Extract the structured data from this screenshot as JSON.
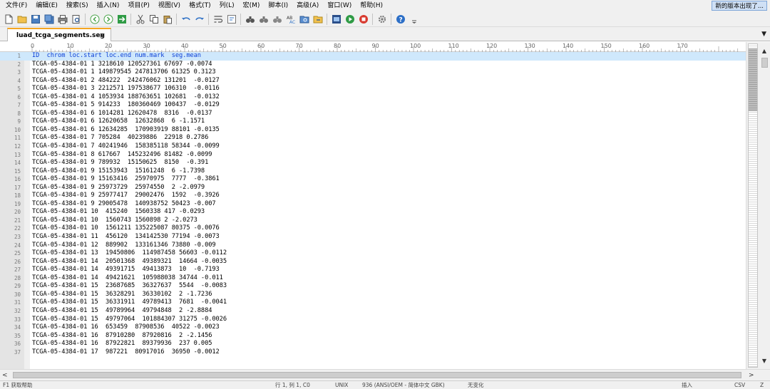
{
  "menu": [
    "文件(F)",
    "编辑(E)",
    "搜索(S)",
    "插入(N)",
    "项目(P)",
    "视图(V)",
    "格式(T)",
    "列(L)",
    "宏(M)",
    "脚本(I)",
    "高级(A)",
    "窗口(W)",
    "帮助(H)"
  ],
  "update_badge": "新的版本出现了...",
  "toolbar_icons": [
    "new-file-icon",
    "open-folder-icon",
    "save-icon",
    "save-all-icon",
    "print-icon",
    "print-preview-icon",
    "back-icon",
    "forward-icon",
    "jump-icon",
    "cut-icon",
    "copy-icon",
    "paste-icon",
    "undo-icon",
    "redo-icon",
    "word-wrap-icon",
    "show-all-chars-icon",
    "find-icon",
    "find-next-icon",
    "find-in-files-icon",
    "replace-icon",
    "find-files-icon",
    "go-to-icon",
    "macro-icon",
    "run-icon",
    "stop-icon",
    "settings-icon",
    "help-icon"
  ],
  "tab": {
    "label": "luad_tcga_segments.seg",
    "close": "×"
  },
  "tab_list_arrow": "▼",
  "ruler": {
    "labels": [
      "0",
      "10",
      "20",
      "30",
      "40",
      "50",
      "60",
      "70",
      "80",
      "90",
      "100",
      "110",
      "120",
      "130",
      "140",
      "150",
      "160",
      "170"
    ]
  },
  "lines": [
    {
      "n": "1",
      "text": "ID  chrom loc.start loc.end num.mark  seg.mean"
    },
    {
      "n": "2",
      "text": "TCGA-05-4384-01 1 3218610 120527361 67697 -0.0074"
    },
    {
      "n": "3",
      "text": "TCGA-05-4384-01 1 149879545 247813706 61325 0.3123"
    },
    {
      "n": "4",
      "text": "TCGA-05-4384-01 2 484222  242476062 131201  -0.0127"
    },
    {
      "n": "5",
      "text": "TCGA-05-4384-01 3 2212571 197538677 106310  -0.0116"
    },
    {
      "n": "6",
      "text": "TCGA-05-4384-01 4 1053934 188763651 102681  -0.0132"
    },
    {
      "n": "7",
      "text": "TCGA-05-4384-01 5 914233  180360469 100437  -0.0129"
    },
    {
      "n": "8",
      "text": "TCGA-05-4384-01 6 1014281 12620478  8316  -0.0137"
    },
    {
      "n": "9",
      "text": "TCGA-05-4384-01 6 12620658  12632868  6 -1.1571"
    },
    {
      "n": "10",
      "text": "TCGA-05-4384-01 6 12634285  170903919 88101 -0.0135"
    },
    {
      "n": "11",
      "text": "TCGA-05-4384-01 7 705284  40239886  22918 0.2786"
    },
    {
      "n": "12",
      "text": "TCGA-05-4384-01 7 40241946  158385118 58344 -0.0099"
    },
    {
      "n": "13",
      "text": "TCGA-05-4384-01 8 617667  145232496 81482 -0.0099"
    },
    {
      "n": "14",
      "text": "TCGA-05-4384-01 9 789932  15150625  8150  -0.391"
    },
    {
      "n": "15",
      "text": "TCGA-05-4384-01 9 15153943  15161248  6 -1.7398"
    },
    {
      "n": "16",
      "text": "TCGA-05-4384-01 9 15163416  25970975  7777  -0.3861"
    },
    {
      "n": "17",
      "text": "TCGA-05-4384-01 9 25973729  25974550  2 -2.0979"
    },
    {
      "n": "18",
      "text": "TCGA-05-4384-01 9 25977417  29002476  1592  -0.3926"
    },
    {
      "n": "19",
      "text": "TCGA-05-4384-01 9 29005478  140938752 50423 -0.007"
    },
    {
      "n": "20",
      "text": "TCGA-05-4384-01 10  415240  1560338 417 -0.0293"
    },
    {
      "n": "21",
      "text": "TCGA-05-4384-01 10  1560743 1560898 2 -2.0273"
    },
    {
      "n": "22",
      "text": "TCGA-05-4384-01 10  1561211 135225087 80375 -0.0076"
    },
    {
      "n": "23",
      "text": "TCGA-05-4384-01 11  456120  134142530 77194 -0.0073"
    },
    {
      "n": "24",
      "text": "TCGA-05-4384-01 12  889902  133161346 73880 -0.009"
    },
    {
      "n": "25",
      "text": "TCGA-05-4384-01 13  19450806  114987458 56603 -0.0112"
    },
    {
      "n": "26",
      "text": "TCGA-05-4384-01 14  20501368  49389321  14664 -0.0035"
    },
    {
      "n": "27",
      "text": "TCGA-05-4384-01 14  49391715  49413873  10  -0.7193"
    },
    {
      "n": "28",
      "text": "TCGA-05-4384-01 14  49421621  105988038 34744 -0.011"
    },
    {
      "n": "29",
      "text": "TCGA-05-4384-01 15  23687685  36327637  5544  -0.0083"
    },
    {
      "n": "30",
      "text": "TCGA-05-4384-01 15  36328291  36330102  2 -1.7236"
    },
    {
      "n": "31",
      "text": "TCGA-05-4384-01 15  36331911  49789413  7681  -0.0041"
    },
    {
      "n": "32",
      "text": "TCGA-05-4384-01 15  49789964  49794848  2 -2.8884"
    },
    {
      "n": "33",
      "text": "TCGA-05-4384-01 15  49797064  101884307 31275 -0.0026"
    },
    {
      "n": "34",
      "text": "TCGA-05-4384-01 16  653459  87908536  40522 -0.0023"
    },
    {
      "n": "35",
      "text": "TCGA-05-4384-01 16  87910280  87920816  2 -2.1456"
    },
    {
      "n": "36",
      "text": "TCGA-05-4384-01 16  87922821  89379936  237 0.005"
    },
    {
      "n": "37",
      "text": "TCGA-05-4384-01 17  987221  80917016  36950 -0.0012"
    }
  ],
  "scroll": {
    "up": "▲",
    "down": "▼",
    "left": "<",
    "right": ">"
  },
  "statusbar": {
    "help": "F1 获取帮助",
    "position": "行 1, 列 1, C0",
    "eol": "UNIX",
    "codepage": "936 (ANSI/OEM - 简体中文 GBK)",
    "modified": "无变化",
    "insert": "插入",
    "col_mode": "CSV",
    "charset": "Z"
  },
  "colors": {
    "current_line_bg": "#cfe8fc",
    "current_line_text": "#0b3fd6",
    "gutter_bg": "#e4e4e4",
    "tab_accent": "#f5a623"
  }
}
